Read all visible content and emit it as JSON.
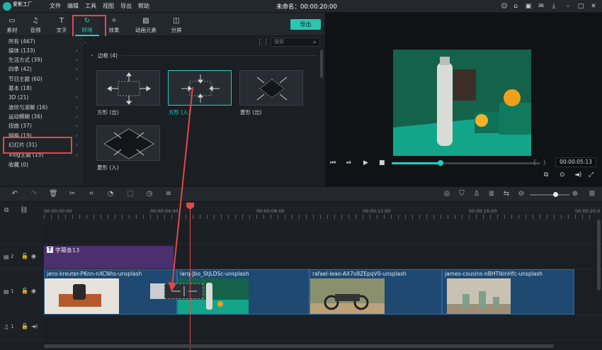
{
  "app": {
    "logo_text": "爱影工厂",
    "window_title": "未命名：00:00:20:00",
    "menu": [
      "文件",
      "编辑",
      "工具",
      "视图",
      "导出",
      "帮助"
    ]
  },
  "toolbar": {
    "tools": [
      {
        "label": "素材",
        "icon": "folder-icon"
      },
      {
        "label": "音频",
        "icon": "music-note-icon"
      },
      {
        "label": "文字",
        "icon": "text-icon"
      },
      {
        "label": "转场",
        "icon": "transition-icon"
      },
      {
        "label": "效果",
        "icon": "effects-icon"
      },
      {
        "label": "动画元素",
        "icon": "image-icon"
      },
      {
        "label": "分屏",
        "icon": "split-screen-icon"
      }
    ],
    "active": "转场",
    "export_label": "导出"
  },
  "categories": [
    {
      "label": "所有 (467)",
      "arrow": false
    },
    {
      "label": "媒体 (133)",
      "arrow": true
    },
    {
      "label": "生活方式 (39)",
      "arrow": true
    },
    {
      "label": "四季 (42)",
      "arrow": true
    },
    {
      "label": "节日主题 (60)",
      "arrow": true
    },
    {
      "label": "基本 (18)",
      "arrow": false
    },
    {
      "label": "3D (21)",
      "arrow": true
    },
    {
      "label": "波纹与溶解 (16)",
      "arrow": true
    },
    {
      "label": "运动模糊 (36)",
      "arrow": true
    },
    {
      "label": "扭曲 (37)",
      "arrow": true
    },
    {
      "label": "网格 (19)",
      "arrow": true
    },
    {
      "label": "幻灯片 (31)",
      "arrow": true
    },
    {
      "label": "Vlog主题 (15)",
      "arrow": true
    },
    {
      "label": "收藏 (0)",
      "arrow": false
    }
  ],
  "content": {
    "search_placeholder": "搜索",
    "section_title": "边框 (4)",
    "items": [
      {
        "label": "方形 (出)",
        "selected": false
      },
      {
        "label": "方形 (入)",
        "selected": true
      },
      {
        "label": "菱形 (出)",
        "selected": false
      },
      {
        "label": "菱形 (入)",
        "selected": false
      }
    ]
  },
  "preview": {
    "timecode": "00:00:05:13",
    "progress": 0.33
  },
  "timeline": {
    "ruler": [
      "00:00:00:00",
      "00:00:04:00",
      "00:00:08:00",
      "00:00:12:00",
      "00:00:16:00",
      "00:00:20:0"
    ],
    "subtitle_clip": "字幕条13",
    "track_labels": [
      "2",
      "1",
      "1"
    ],
    "clips": [
      "jens-kreuter-PKnn-nXCNhs-unsplash",
      "larq-Jbo_StjLDSc-unsplash",
      "rafael-leao-AX7o8ZEpqV0-unsplash",
      "james-cousins-nBHTlklnHfc-unsplash"
    ]
  },
  "colors": {
    "accent": "#1fd1bd",
    "highlight": "#e04848",
    "clip": "#1e4a72",
    "subtitle": "#4c2f6e"
  }
}
